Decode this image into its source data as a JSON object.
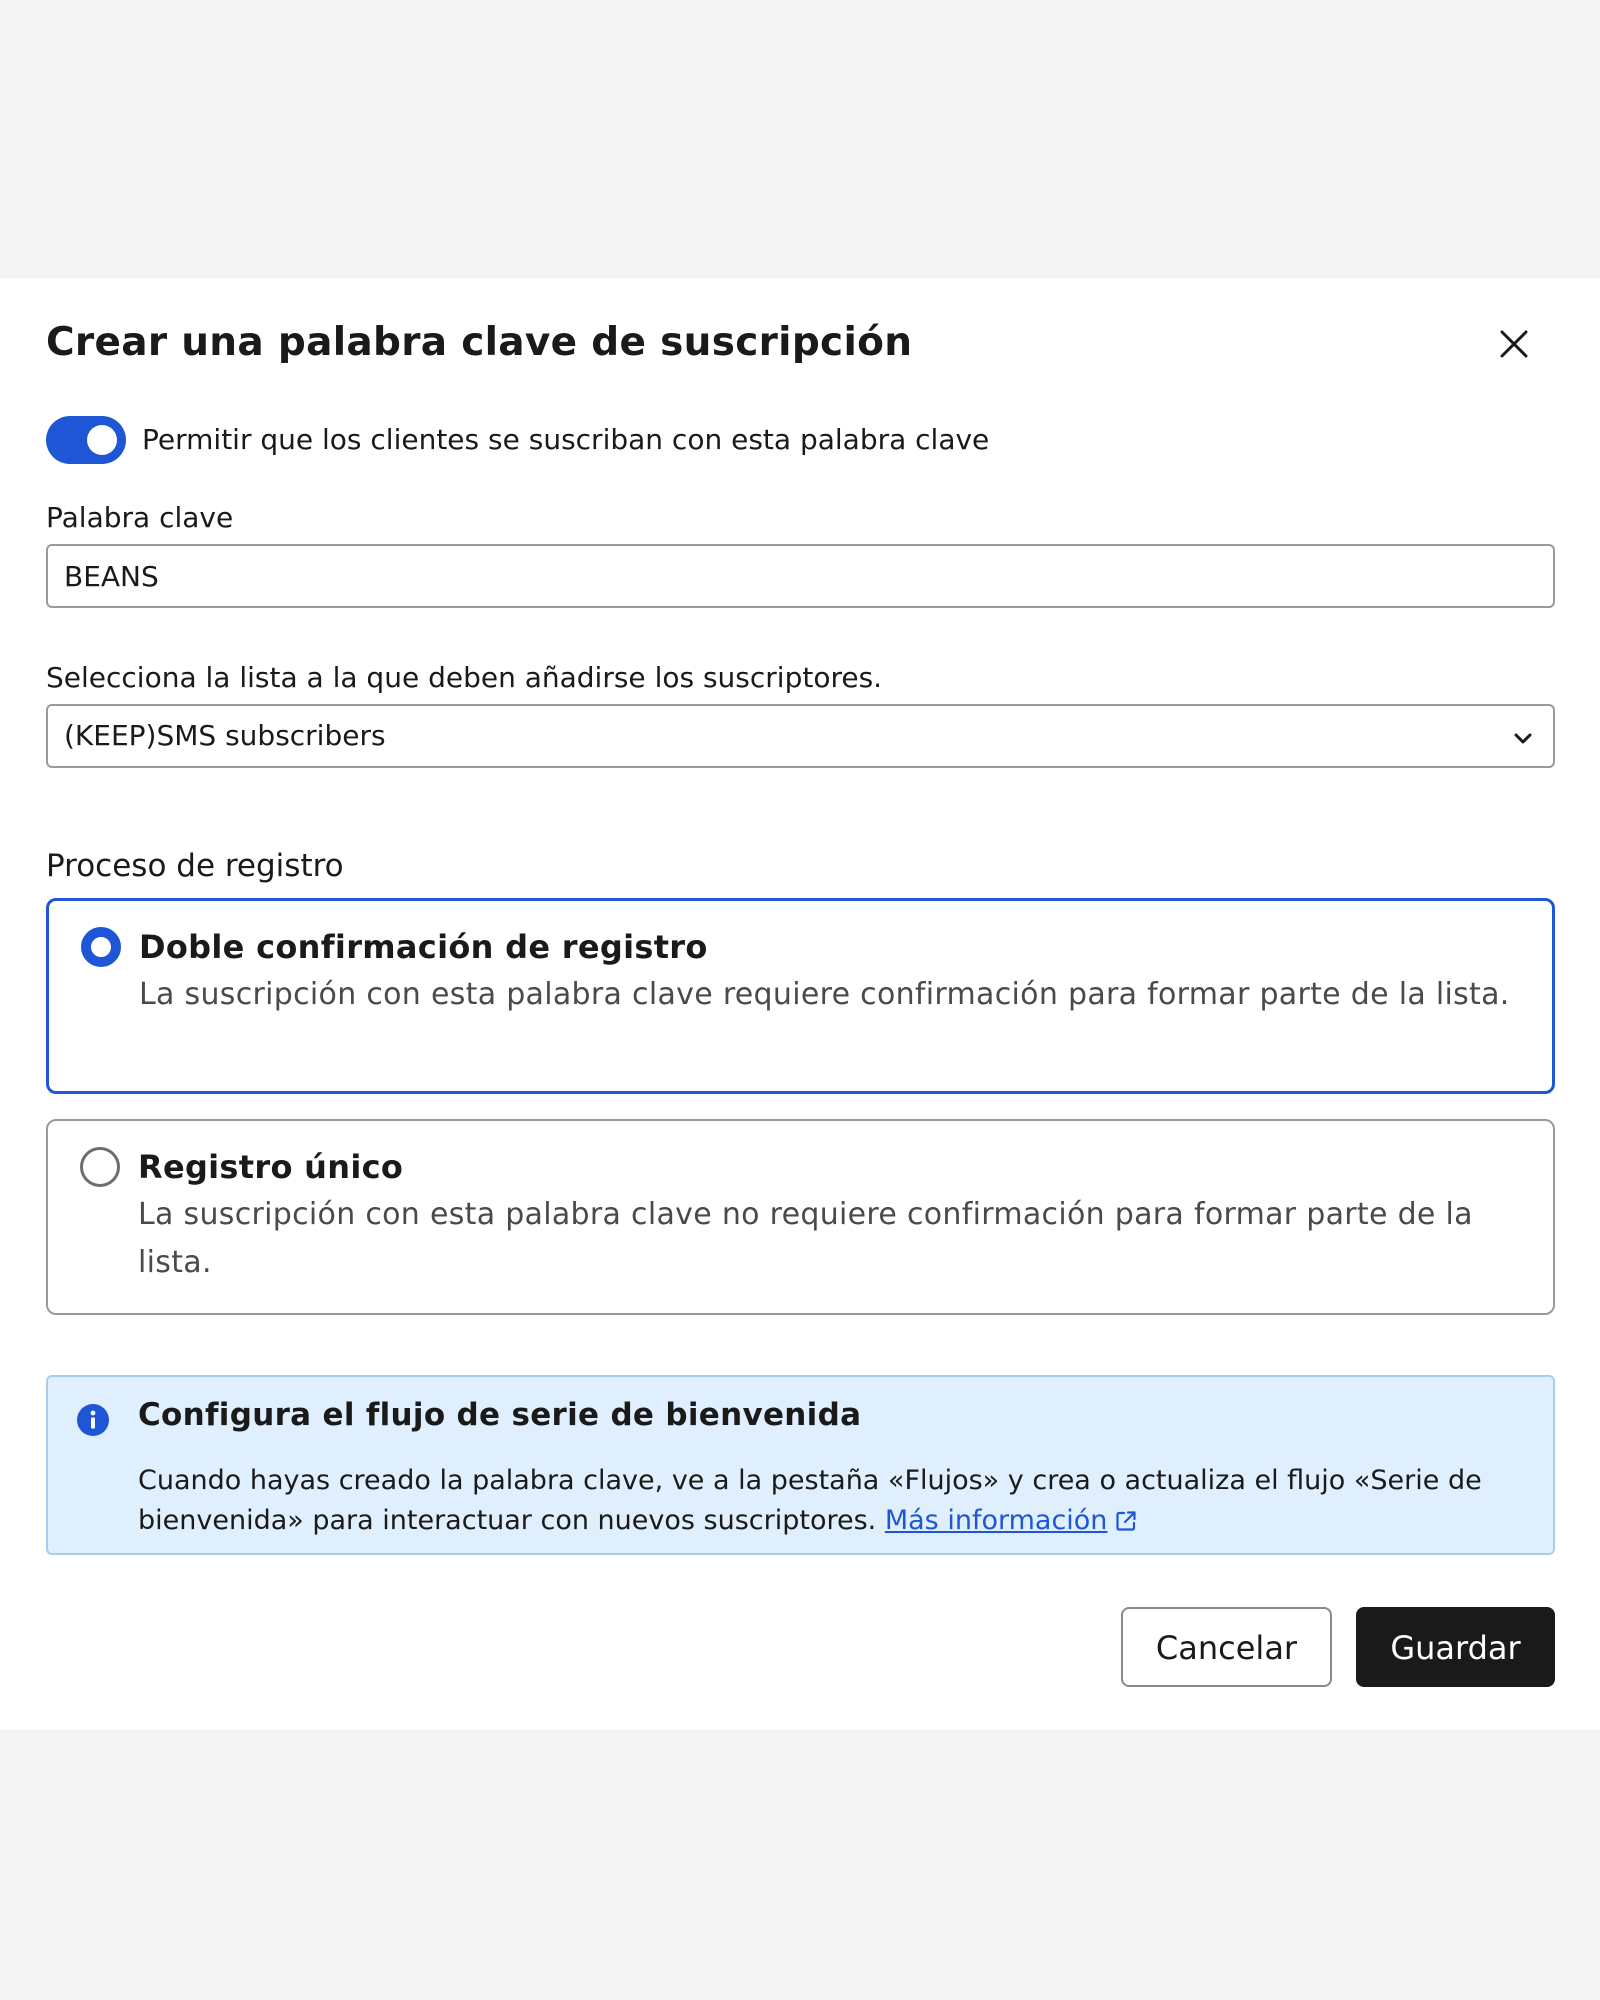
{
  "modal": {
    "title": "Crear una palabra clave de suscripción"
  },
  "toggle": {
    "label": "Permitir que los clientes se suscriban con esta palabra clave",
    "on": true
  },
  "keyword": {
    "label": "Palabra clave",
    "value": "BEANS"
  },
  "list": {
    "label": "Selecciona la lista a la que deben añadirse los suscriptores.",
    "selected": "(KEEP)SMS subscribers"
  },
  "signup": {
    "label": "Proceso de registro",
    "options": [
      {
        "title": "Doble confirmación de registro",
        "description": "La suscripción con esta palabra clave requiere confirmación para formar parte de la lista.",
        "selected": true
      },
      {
        "title": "Registro único",
        "description": "La suscripción con esta palabra clave no requiere confirmación para formar parte de la lista.",
        "selected": false
      }
    ]
  },
  "info": {
    "title": "Configura el flujo de serie de bienvenida",
    "body": "Cuando hayas creado la palabra clave, ve a la pestaña «Flujos» y crea o actualiza el flujo «Serie de bienvenida» para interactuar con nuevos suscriptores.",
    "link": "Más información"
  },
  "actions": {
    "cancel": "Cancelar",
    "save": "Guardar"
  },
  "colors": {
    "accent": "#1f56d6",
    "info_bg": "#dfeffd",
    "primary_button": "#1a1a1a"
  },
  "icons": {
    "close": "close-icon",
    "chevron": "chevron-down-icon",
    "info": "info-icon",
    "external": "external-link-icon"
  }
}
